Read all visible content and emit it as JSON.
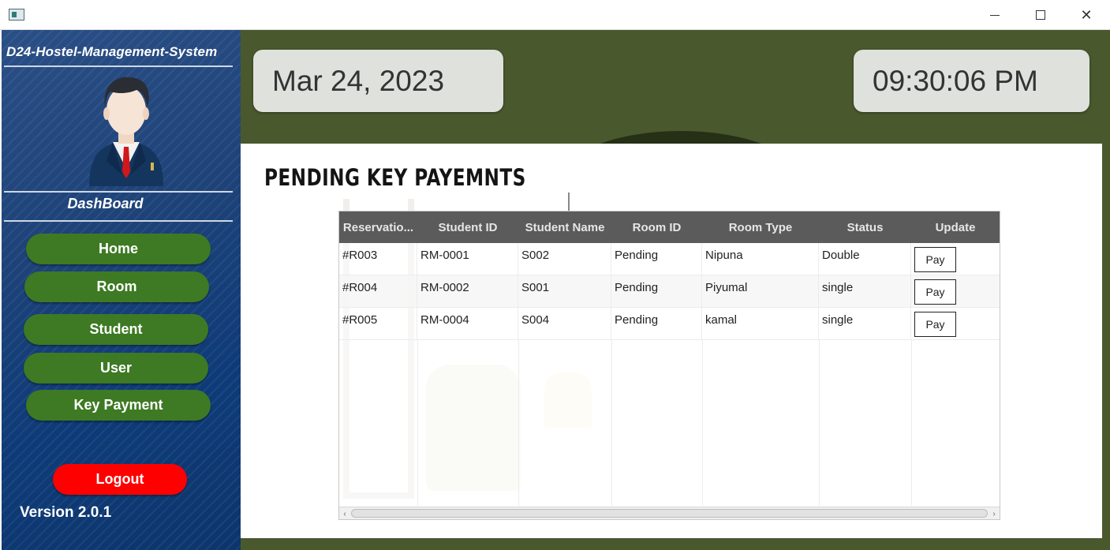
{
  "window": {
    "app_icon": "app-window-icon",
    "controls": [
      "minimize-icon",
      "maximize-icon",
      "close-icon"
    ],
    "close_glyph": "✕"
  },
  "sidebar": {
    "app_title": "D24-Hostel-Management-System",
    "avatar_icon": "businessman-avatar",
    "dashboard_label": "DashBoard",
    "nav": [
      {
        "label": "Home"
      },
      {
        "label": "Room"
      },
      {
        "label": "Student"
      },
      {
        "label": "User"
      },
      {
        "label": "Key Payment"
      }
    ],
    "logout_label": "Logout",
    "version": "Version 2.0.1"
  },
  "header": {
    "date": "Mar 24, 2023",
    "time": "09:30:06 PM"
  },
  "main": {
    "title": "PENDING KEY PAYEMNTS",
    "table": {
      "columns": [
        "Reservatio...",
        "Student ID",
        "Student Name",
        "Room ID",
        "Room Type",
        "Status",
        "Update"
      ],
      "rows": [
        {
          "c1": "#R003",
          "c2": "RM-0001",
          "c3": "S002",
          "c4": "Pending",
          "c5": "Nipuna",
          "c6": "Double",
          "action": "Pay"
        },
        {
          "c1": "#R004",
          "c2": "RM-0002",
          "c3": "S001",
          "c4": "Pending",
          "c5": "Piyumal",
          "c6": "single",
          "action": "Pay"
        },
        {
          "c1": "#R005",
          "c2": "RM-0004",
          "c3": "S004",
          "c4": "Pending",
          "c5": "kamal",
          "c6": "single",
          "action": "Pay"
        }
      ]
    }
  },
  "colors": {
    "sidebar_blue": "#1d4278",
    "nav_green": "#3d7a23",
    "logout_red": "#ff0000",
    "main_olive": "#4a582d",
    "table_header": "#5b5b5b"
  }
}
